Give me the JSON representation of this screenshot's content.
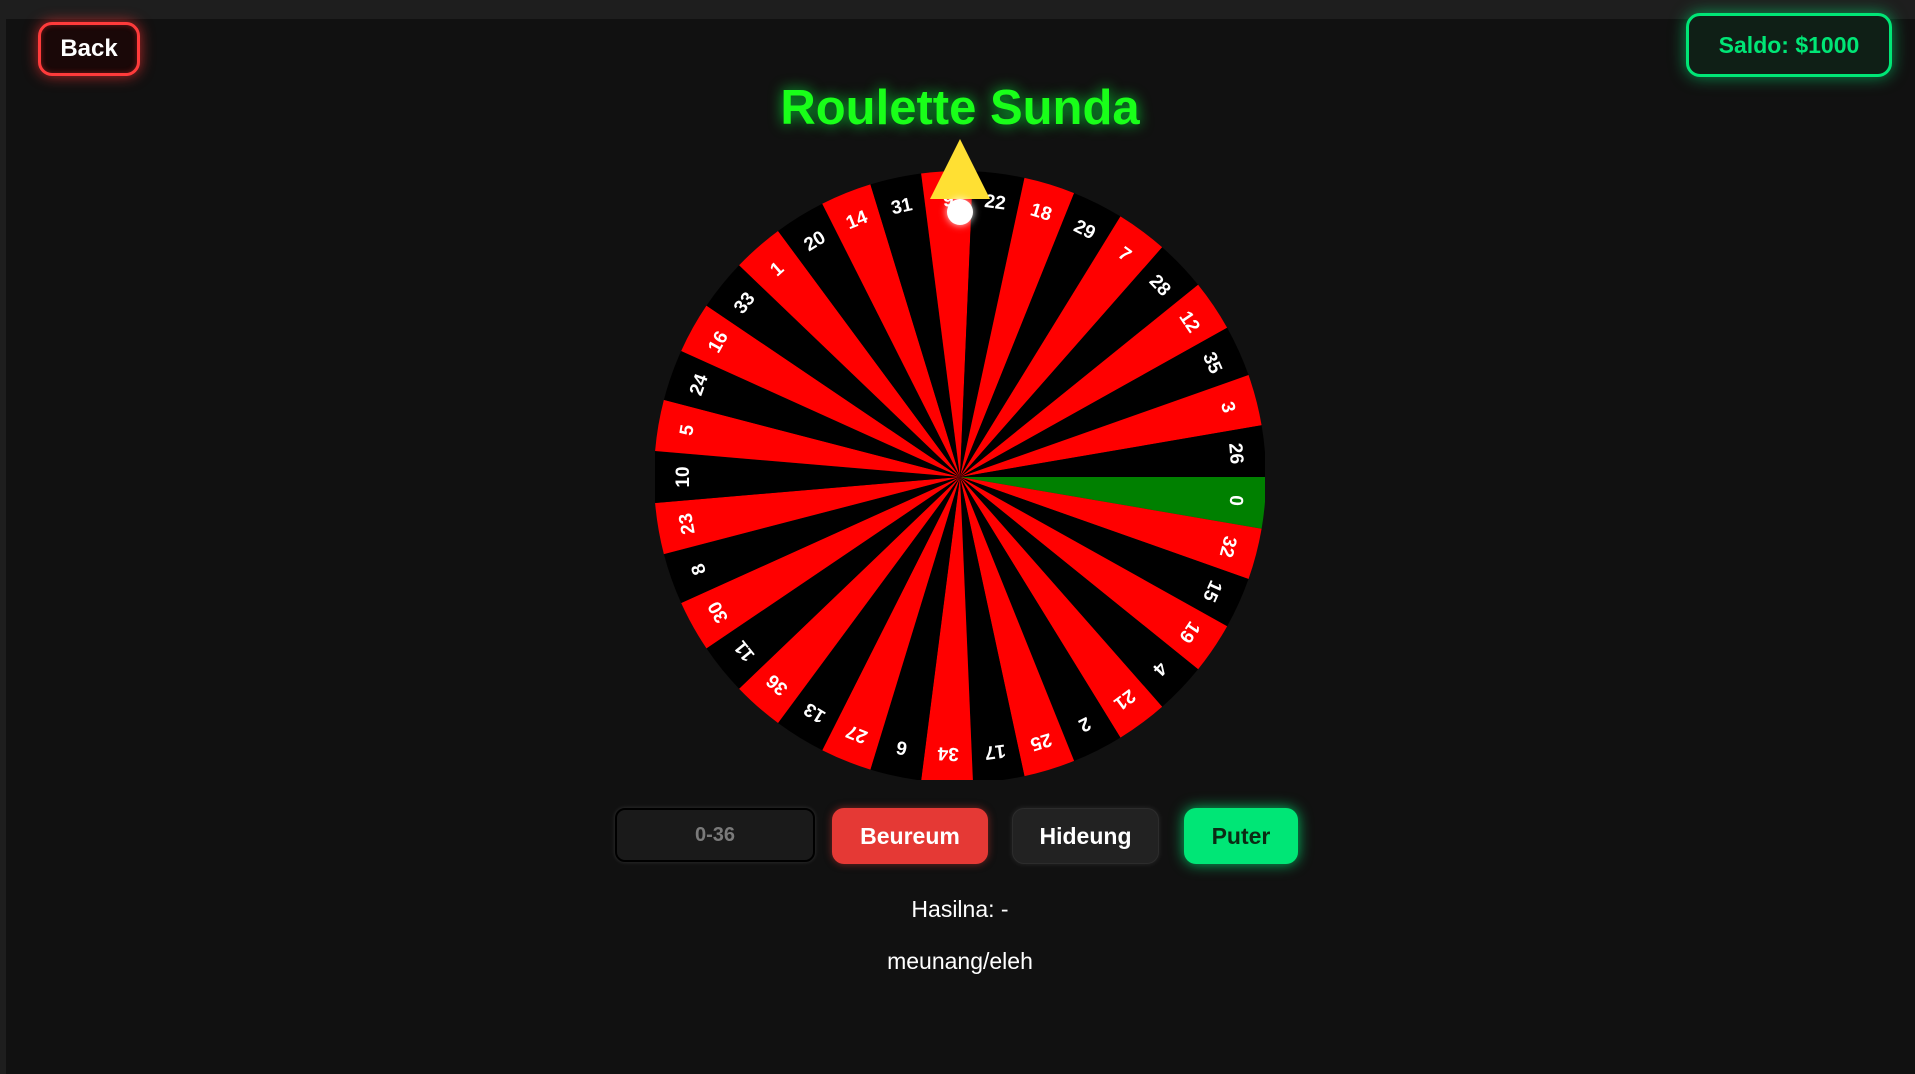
{
  "header": {
    "back_label": "Back",
    "balance_label": "Saldo: $1000",
    "title": "Roulette Sunda"
  },
  "wheel": {
    "numbers": [
      "0",
      "32",
      "15",
      "19",
      "4",
      "21",
      "2",
      "25",
      "17",
      "34",
      "6",
      "27",
      "13",
      "36",
      "11",
      "30",
      "8",
      "23",
      "10",
      "5",
      "24",
      "16",
      "33",
      "1",
      "20",
      "14",
      "31",
      "9",
      "22",
      "18",
      "29",
      "7",
      "28",
      "12",
      "35",
      "3",
      "26"
    ],
    "colors": [
      "green",
      "red",
      "black",
      "red",
      "black",
      "red",
      "black",
      "red",
      "black",
      "red",
      "black",
      "red",
      "black",
      "red",
      "black",
      "red",
      "black",
      "red",
      "black",
      "red",
      "black",
      "red",
      "black",
      "red",
      "black",
      "red",
      "black",
      "red",
      "black",
      "red",
      "black",
      "red",
      "black",
      "red",
      "black",
      "red",
      "black"
    ],
    "palette": {
      "red": "#ff0000",
      "black": "#000000",
      "green": "#008000",
      "pointer": "#ffe033",
      "ball": "#ffffff",
      "label": "#ffffff"
    },
    "pointer_icon": "triangle-pointer-icon",
    "ball_icon": "ball-icon"
  },
  "controls": {
    "number_placeholder": "0-36",
    "number_value": "",
    "red_label": "Beureum",
    "black_label": "Hideung",
    "spin_label": "Puter"
  },
  "result": {
    "result_text": "Hasilna: -",
    "status_text": "meunang/eleh"
  }
}
